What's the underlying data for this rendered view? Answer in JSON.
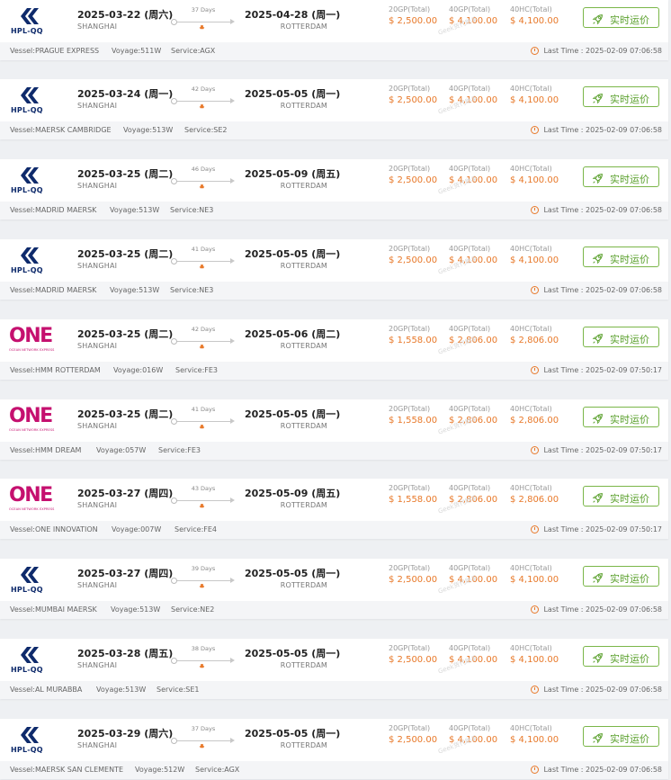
{
  "button_label": "实时运价",
  "watermark_text": "Geek货代助手",
  "accent_orange": "#e8792a",
  "button_green": "#5aa02c",
  "price_labels": [
    "20GP(Total)",
    "40GP(Total)",
    "40HC(Total)"
  ],
  "last_time_label": "Last Time : ",
  "routes": [
    {
      "carrier": "HPL-QQ",
      "logo_type": "hapag-lloyd-icon",
      "dep_date": "2025-03-22 (周六)",
      "dep_port": "SHANGHAI",
      "transit": "37 Days",
      "arr_date": "2025-04-28 (周一)",
      "arr_port": "ROTTERDAM",
      "prices": [
        "$ 2,500.00",
        "$ 4,100.00",
        "$ 4,100.00"
      ],
      "vessel": "Vessel:PRAGUE EXPRESS",
      "voyage": "Voyage:511W",
      "service": "Service:AGX",
      "last_time": "2025-02-09 07:06:58"
    },
    {
      "carrier": "HPL-QQ",
      "logo_type": "hapag-lloyd-icon",
      "dep_date": "2025-03-24 (周一)",
      "dep_port": "SHANGHAI",
      "transit": "42 Days",
      "arr_date": "2025-05-05 (周一)",
      "arr_port": "ROTTERDAM",
      "prices": [
        "$ 2,500.00",
        "$ 4,100.00",
        "$ 4,100.00"
      ],
      "vessel": "Vessel:MAERSK CAMBRIDGE",
      "voyage": "Voyage:513W",
      "service": "Service:SE2",
      "last_time": "2025-02-09 07:06:58"
    },
    {
      "carrier": "HPL-QQ",
      "logo_type": "hapag-lloyd-icon",
      "dep_date": "2025-03-25 (周二)",
      "dep_port": "SHANGHAI",
      "transit": "46 Days",
      "arr_date": "2025-05-09 (周五)",
      "arr_port": "ROTTERDAM",
      "prices": [
        "$ 2,500.00",
        "$ 4,100.00",
        "$ 4,100.00"
      ],
      "vessel": "Vessel:MADRID MAERSK",
      "voyage": "Voyage:513W",
      "service": "Service:NE3",
      "last_time": "2025-02-09 07:06:58"
    },
    {
      "carrier": "HPL-QQ",
      "logo_type": "hapag-lloyd-icon",
      "dep_date": "2025-03-25 (周二)",
      "dep_port": "SHANGHAI",
      "transit": "41 Days",
      "arr_date": "2025-05-05 (周一)",
      "arr_port": "ROTTERDAM",
      "prices": [
        "$ 2,500.00",
        "$ 4,100.00",
        "$ 4,100.00"
      ],
      "vessel": "Vessel:MADRID MAERSK",
      "voyage": "Voyage:513W",
      "service": "Service:NE3",
      "last_time": "2025-02-09 07:06:58"
    },
    {
      "carrier": "ONE",
      "carrier_sub": "OCEAN NETWORK EXPRESS",
      "logo_type": "one-logo",
      "dep_date": "2025-03-25 (周二)",
      "dep_port": "SHANGHAI",
      "transit": "42 Days",
      "arr_date": "2025-05-06 (周二)",
      "arr_port": "ROTTERDAM",
      "prices": [
        "$ 1,558.00",
        "$ 2,806.00",
        "$ 2,806.00"
      ],
      "vessel": "Vessel:HMM ROTTERDAM",
      "voyage": "Voyage:016W",
      "service": "Service:FE3",
      "last_time": "2025-02-09 07:50:17"
    },
    {
      "carrier": "ONE",
      "carrier_sub": "OCEAN NETWORK EXPRESS",
      "logo_type": "one-logo",
      "dep_date": "2025-03-25 (周二)",
      "dep_port": "SHANGHAI",
      "transit": "41 Days",
      "arr_date": "2025-05-05 (周一)",
      "arr_port": "ROTTERDAM",
      "prices": [
        "$ 1,558.00",
        "$ 2,806.00",
        "$ 2,806.00"
      ],
      "vessel": "Vessel:HMM DREAM",
      "voyage": "Voyage:057W",
      "service": "Service:FE3",
      "last_time": "2025-02-09 07:50:17"
    },
    {
      "carrier": "ONE",
      "carrier_sub": "OCEAN NETWORK EXPRESS",
      "logo_type": "one-logo",
      "dep_date": "2025-03-27 (周四)",
      "dep_port": "SHANGHAI",
      "transit": "43 Days",
      "arr_date": "2025-05-09 (周五)",
      "arr_port": "ROTTERDAM",
      "prices": [
        "$ 1,558.00",
        "$ 2,806.00",
        "$ 2,806.00"
      ],
      "vessel": "Vessel:ONE INNOVATION",
      "voyage": "Voyage:007W",
      "service": "Service:FE4",
      "last_time": "2025-02-09 07:50:17"
    },
    {
      "carrier": "HPL-QQ",
      "logo_type": "hapag-lloyd-icon",
      "dep_date": "2025-03-27 (周四)",
      "dep_port": "SHANGHAI",
      "transit": "39 Days",
      "arr_date": "2025-05-05 (周一)",
      "arr_port": "ROTTERDAM",
      "prices": [
        "$ 2,500.00",
        "$ 4,100.00",
        "$ 4,100.00"
      ],
      "vessel": "Vessel:MUMBAI MAERSK",
      "voyage": "Voyage:513W",
      "service": "Service:NE2",
      "last_time": "2025-02-09 07:06:58"
    },
    {
      "carrier": "HPL-QQ",
      "logo_type": "hapag-lloyd-icon",
      "dep_date": "2025-03-28 (周五)",
      "dep_port": "SHANGHAI",
      "transit": "38 Days",
      "arr_date": "2025-05-05 (周一)",
      "arr_port": "ROTTERDAM",
      "prices": [
        "$ 2,500.00",
        "$ 4,100.00",
        "$ 4,100.00"
      ],
      "vessel": "Vessel:AL MURABBA",
      "voyage": "Voyage:513W",
      "service": "Service:SE1",
      "last_time": "2025-02-09 07:06:58"
    },
    {
      "carrier": "HPL-QQ",
      "logo_type": "hapag-lloyd-icon",
      "dep_date": "2025-03-29 (周六)",
      "dep_port": "SHANGHAI",
      "transit": "37 Days",
      "arr_date": "2025-05-05 (周一)",
      "arr_port": "ROTTERDAM",
      "prices": [
        "$ 2,500.00",
        "$ 4,100.00",
        "$ 4,100.00"
      ],
      "vessel": "Vessel:MAERSK SAN CLEMENTE",
      "voyage": "Voyage:512W",
      "service": "Service:AGX",
      "last_time": "2025-02-09 07:06:58"
    }
  ]
}
